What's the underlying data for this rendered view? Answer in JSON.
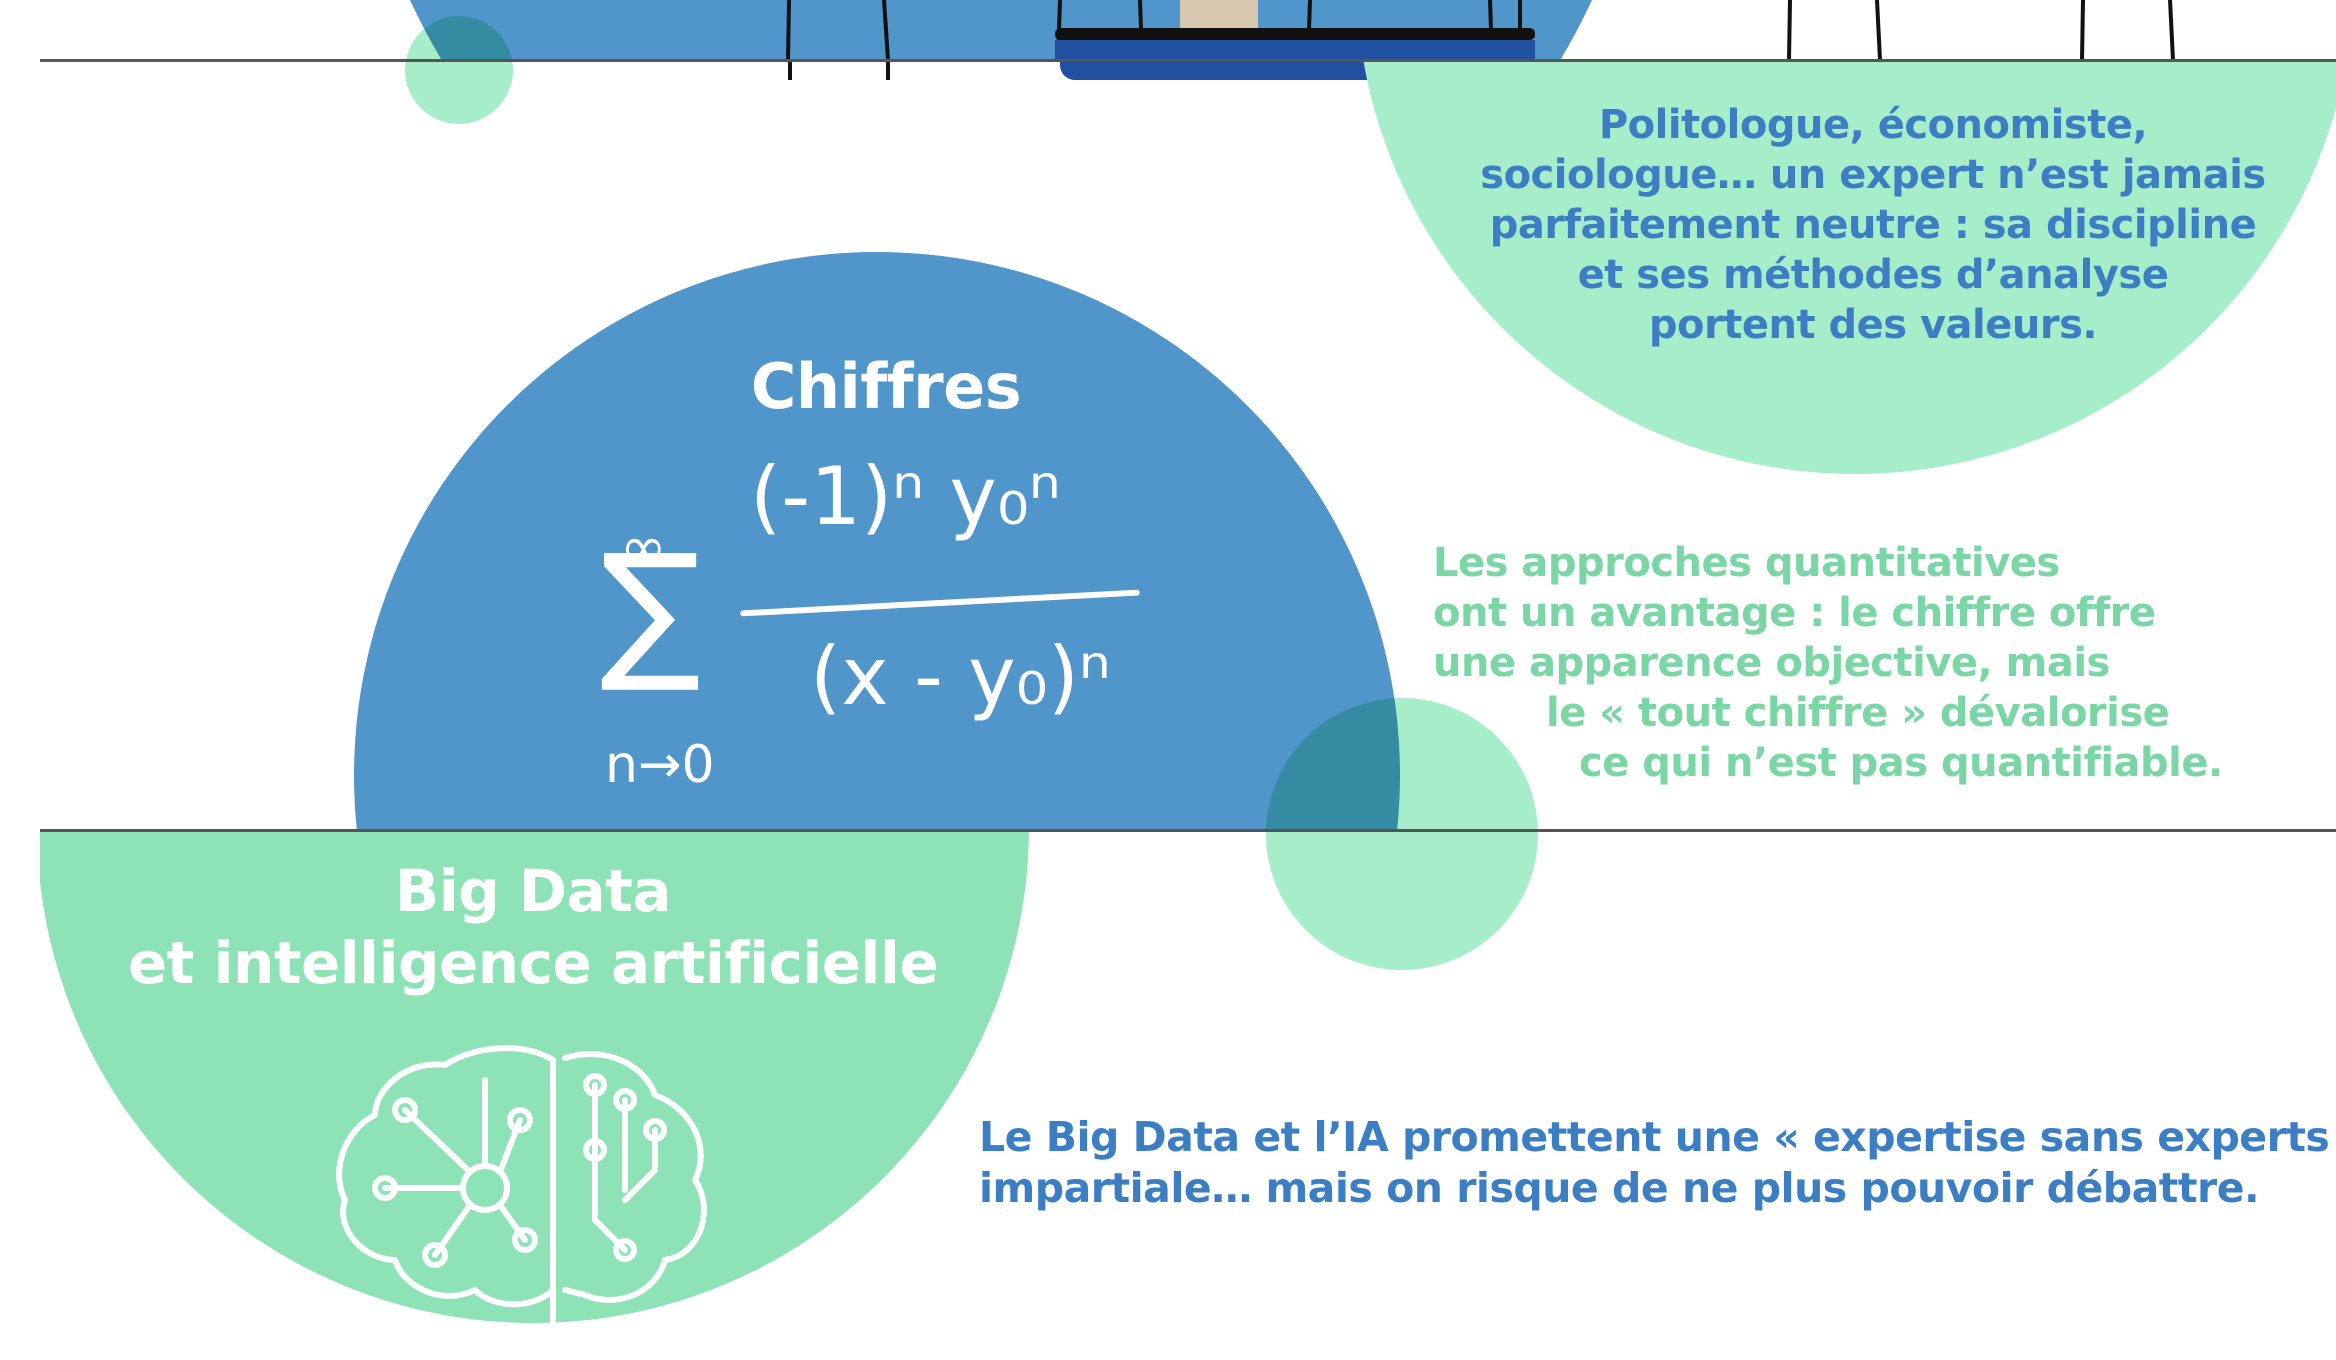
{
  "colors": {
    "blue": "#5196cb",
    "green_light": "#a6edca",
    "green": "#8de3b6",
    "text_blue": "#3c7ec3",
    "text_green": "#7bd6a5"
  },
  "experts": {
    "lines": [
      "Politologue, économiste,",
      "sociologue… un expert n’est jamais",
      "parfaitement neutre : sa discipline",
      "et ses méthodes d’analyse",
      "portent des valeurs."
    ]
  },
  "chiffres": {
    "title": "Chiffres",
    "formula": {
      "sum_top": "∞",
      "sum_bottom": "n→0",
      "numerator": "(-1)ⁿ y₀ⁿ",
      "denominator": "(x - y₀)ⁿ"
    },
    "lines": [
      "Les approches quantitatives",
      "ont un avantage : le chiffre offre",
      "une apparence objective, mais",
      "le « tout chiffre » dévalorise",
      "ce qui n’est pas quantifiable."
    ]
  },
  "bigdata": {
    "title_line1": "Big Data",
    "title_line2": "et intelligence artificielle",
    "lines": [
      "Le Big Data et l’IA promettent une « expertise sans experts »,",
      "impartiale… mais on risque de ne plus pouvoir débattre."
    ]
  }
}
